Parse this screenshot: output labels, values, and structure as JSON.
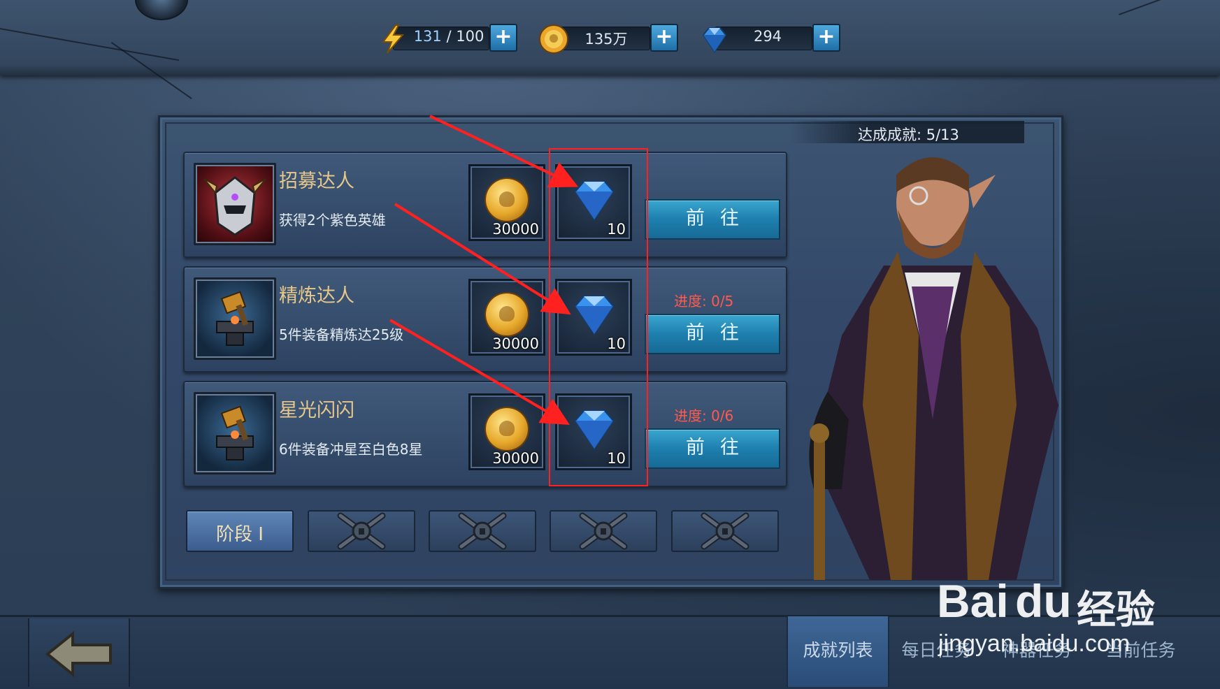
{
  "resources": {
    "energy": {
      "current": "131",
      "max": "100",
      "separator": " / "
    },
    "gold": {
      "value": "135万"
    },
    "diamonds": {
      "value": "294"
    },
    "plus_label": "+"
  },
  "achievements_header": {
    "label": "达成成就: 5/13",
    "done": 5,
    "total": 13
  },
  "achievements": [
    {
      "title": "招募达人",
      "desc": "获得2个紫色英雄",
      "gold": "30000",
      "gems": "10",
      "progress": "",
      "go_label": "前往"
    },
    {
      "title": "精炼达人",
      "desc": "5件装备精炼达25级",
      "gold": "30000",
      "gems": "10",
      "progress": "进度: 0/5",
      "go_label": "前往"
    },
    {
      "title": "星光闪闪",
      "desc": "6件装备冲星至白色8星",
      "gold": "30000",
      "gems": "10",
      "progress": "进度: 0/6",
      "go_label": "前往"
    }
  ],
  "stages": [
    {
      "label": "阶段 I",
      "active": true,
      "locked": false
    },
    {
      "label": "",
      "active": false,
      "locked": true
    },
    {
      "label": "",
      "active": false,
      "locked": true
    },
    {
      "label": "",
      "active": false,
      "locked": true
    },
    {
      "label": "",
      "active": false,
      "locked": true
    }
  ],
  "tabs": [
    "成就列表",
    "每日任务",
    "神器任务",
    "当前任务"
  ],
  "watermark": {
    "brand_a": "Bai",
    "brand_b": "du",
    "brand_c": "经验",
    "url": "jingyan.baidu.com"
  },
  "colors": {
    "accent": "#1e7fae",
    "progress": "#ff5a4d",
    "title": "#e7c88a",
    "annotation": "#ff2020"
  },
  "icons": [
    "energy-icon",
    "gold-coin-icon",
    "diamond-icon",
    "plus-icon",
    "back-arrow-icon",
    "lock-icon"
  ]
}
